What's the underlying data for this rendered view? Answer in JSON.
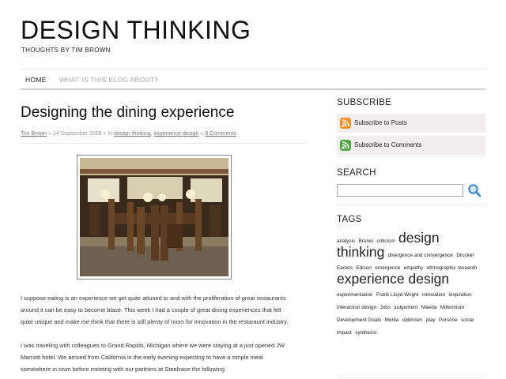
{
  "site": {
    "title": "DESIGN THINKING",
    "tagline": "THOUGHTS BY TIM BROWN"
  },
  "nav": {
    "items": [
      {
        "label": "HOME"
      },
      {
        "label": "WHAT IS THIS BLOG ABOUT?"
      }
    ]
  },
  "post": {
    "title": "Designing the dining experience",
    "author": "Tim Brown",
    "date_sep": " » 14 September 2008 » In ",
    "category1": "design thinking",
    "comma": ", ",
    "category2": "experience design",
    "comments_sep": " » ",
    "comments": "8 Comments",
    "paragraphs": [
      "I suppose eating is an experience we get quite attuned to and with the proliferation of great restaurants around it can be easy to become blasé. This week I had a couple of great dining experiences that felt quite unique and make me think that there is still plenty of room for innovation in the restaraunt industry.",
      "I  was traveling with colleagues to Grand Rapids, Michigan where we were staying at a just opened JW Marriott hotel. We arrived from California in the early evening expecting to have a simple meal somewhere in town before meeting with our partners at Steelcase the following"
    ]
  },
  "sidebar": {
    "subscribe_heading": "SUBSCRIBE",
    "subscribe_posts": "Subscribe to Posts",
    "subscribe_comments": "Subscribe to Comments",
    "search_heading": "SEARCH",
    "search_value": "",
    "tags_heading": "TAGS",
    "tags": [
      {
        "text": "analysis",
        "size": "s"
      },
      {
        "text": "Brunel",
        "size": "s"
      },
      {
        "text": "criticism",
        "size": "s"
      },
      {
        "text": "design thinking",
        "size": "l"
      },
      {
        "text": "divergence and convergence",
        "size": "s"
      },
      {
        "text": "Drucker",
        "size": "s"
      },
      {
        "text": "Eames",
        "size": "s"
      },
      {
        "text": "Edison",
        "size": "s"
      },
      {
        "text": "emergence",
        "size": "s"
      },
      {
        "text": "empathy",
        "size": "s"
      },
      {
        "text": "ethnographic research",
        "size": "s"
      },
      {
        "text": "experience design",
        "size": "l"
      },
      {
        "text": "experimentation",
        "size": "s"
      },
      {
        "text": "Frank Lloyd Wright",
        "size": "s"
      },
      {
        "text": "innovation",
        "size": "s"
      },
      {
        "text": "inspiration",
        "size": "s"
      },
      {
        "text": "interaction design",
        "size": "s"
      },
      {
        "text": "Jobs",
        "size": "s"
      },
      {
        "text": "judgement",
        "size": "s"
      },
      {
        "text": "Maeda",
        "size": "s"
      },
      {
        "text": "Millennium Development Goals",
        "size": "s"
      },
      {
        "text": "Morita",
        "size": "s"
      },
      {
        "text": "optimism",
        "size": "s"
      },
      {
        "text": "play",
        "size": "s"
      },
      {
        "text": "Porsche",
        "size": "s"
      },
      {
        "text": "social impact",
        "size": "s"
      },
      {
        "text": "synthesis",
        "size": "s"
      }
    ]
  },
  "colors": {
    "feed_orange": "#f28c28",
    "feed_green": "#4caa3c",
    "subscribe_bg": "#f2eef0"
  }
}
